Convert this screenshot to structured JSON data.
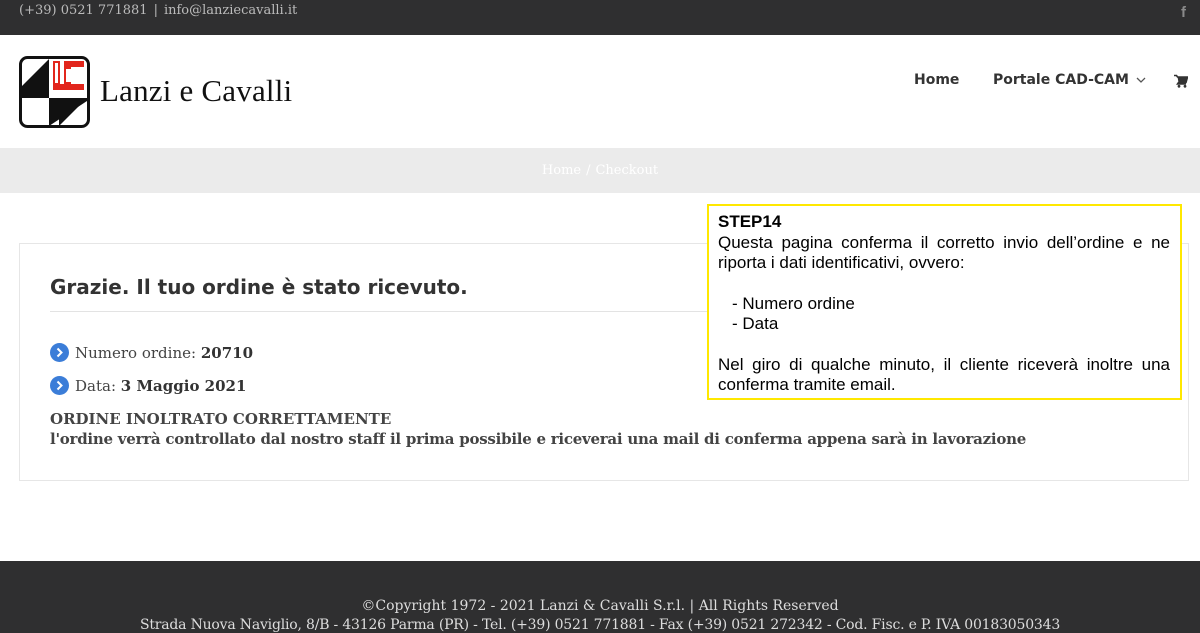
{
  "topbar": {
    "phone": "(+39) 0521 771881",
    "separator": "|",
    "email": "info@lanziecavalli.it",
    "social_icon": "facebook-icon",
    "social_glyph": "f"
  },
  "header": {
    "brand": "Lanzi e Cavalli",
    "logo_icon": "lanzi-cavalli-logo",
    "nav": {
      "home": "Home",
      "portal": "Portale CAD-CAM"
    },
    "cart_icon": "shopping-cart-icon"
  },
  "breadcrumb": {
    "home": "Home",
    "separator": "/",
    "current": "Checkout"
  },
  "order": {
    "title": "Grazie. Il tuo ordine è stato ricevuto.",
    "number_label": "Numero ordine:",
    "number_value": "20710",
    "date_label": "Data:",
    "date_value": "3 Maggio 2021",
    "status_title": "ORDINE INOLTRATO CORRETTAMENTE",
    "status_text": "l'ordine verrà controllato dal nostro staff il prima possibile e riceverai una mail di conferma appena sarà in lavorazione"
  },
  "callout": {
    "step": "STEP14",
    "intro": "Questa pagina conferma il corretto invio dell’ordine e ne riporta i dati identificativi, ovvero:",
    "item1": "- Numero ordine",
    "item2": "- Data",
    "outro": "Nel giro di qualche minuto, il cliente riceverà inoltre una conferma tramite email."
  },
  "footer": {
    "copyright": "©Copyright 1972 - 2021 Lanzi & Cavalli S.r.l. | All Rights Reserved",
    "address": "Strada Nuova Naviglio, 8/B - 43126 Parma (PR) - Tel. (+39) 0521 771881 - Fax (+39) 0521 272342 - Cod. Fisc. e P. IVA 00183050343"
  },
  "colors": {
    "dark_bar": "#2f2f30",
    "breadcrumb_bar": "#ebebeb",
    "callout_border": "#ffe800",
    "bullet_blue": "#3b7dd8",
    "logo_red": "#e2261c"
  }
}
